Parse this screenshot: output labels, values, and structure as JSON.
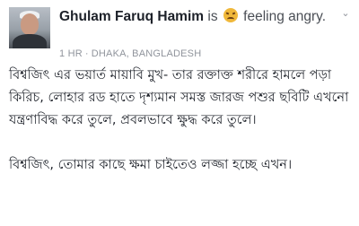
{
  "post": {
    "author": "Ghulam Faruq Hamim",
    "status_prefix": " is ",
    "feeling_icon": "angry-face-emoji",
    "status_suffix": " feeling angry.",
    "time": "1 HR",
    "location": "DHAKA, BANGLADESH",
    "privacy_icon": "chevron-down-icon",
    "paragraphs": [
      "বিশ্বজিৎ এর ভয়ার্ত মায়াবি মুখ- তার রক্তাক্ত শরীরে হামলে পড়া কিরিচ, লোহার রড হাতে দৃশ্যমান সমস্ত জারজ পশুর ছবিটি এখনো যন্ত্রণাবিদ্ধ করে তুলে, প্রবলভাবে ক্ষুদ্ধ করে তুলে।",
      "বিশ্বজিৎ, তোমার কাছে ক্ষমা চাইতেও লজ্জা হচ্ছে এখন।"
    ]
  }
}
